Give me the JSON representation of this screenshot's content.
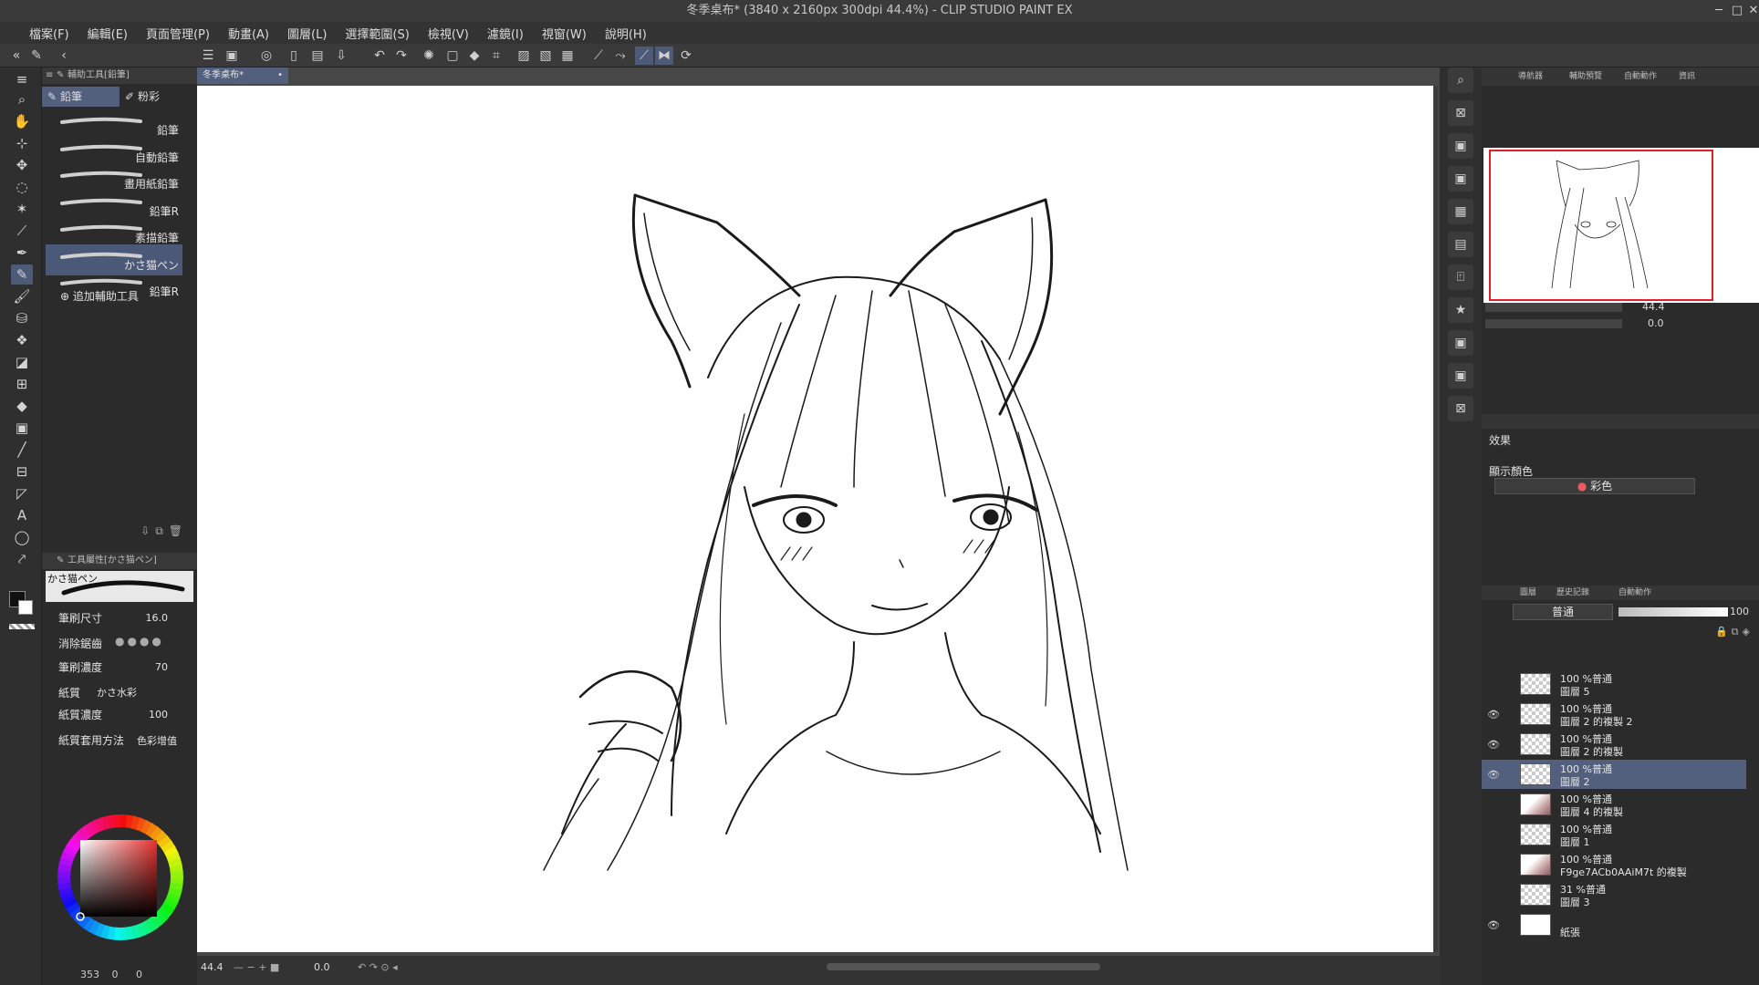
{
  "window": {
    "title": "冬季桌布* (3840 x 2160px 300dpi 44.4%)  - CLIP STUDIO PAINT EX"
  },
  "menu": [
    "檔案(F)",
    "編輯(E)",
    "頁面管理(P)",
    "動畫(A)",
    "圖層(L)",
    "選擇範圍(S)",
    "檢視(V)",
    "濾鏡(I)",
    "視窗(W)",
    "說明(H)"
  ],
  "subtool": {
    "header": "輔助工具[鉛筆]",
    "tabs": [
      "鉛筆",
      "粉彩"
    ],
    "brushes": [
      "鉛筆",
      "自動鉛筆",
      "畫用紙鉛筆",
      "鉛筆R",
      "素描鉛筆",
      "かさ猫ペン",
      "鉛筆R"
    ],
    "selected_brush": "かさ猫ペン",
    "add_label": "追加輔助工具"
  },
  "tool_property": {
    "header": "工具屬性[かさ猫ペン]",
    "preview_name": "かさ猫ペン",
    "brush_size_label": "筆刷尺寸",
    "brush_size_value": "16.0",
    "anti_alias_label": "消除鋸齒",
    "density_label": "筆刷濃度",
    "density_value": "70",
    "paper_label": "紙質",
    "paper_value": "かさ水彩",
    "paper_density_label": "紙質濃度",
    "paper_density_value": "100",
    "paper_apply_label": "紙質套用方法",
    "paper_apply_value": "色彩增值"
  },
  "color_panel": {
    "readout": "353",
    "values": [
      "0",
      "0"
    ],
    "main_color": "#111111",
    "sub_color": "#ffffff",
    "hue_color": "#e8322f"
  },
  "canvas": {
    "doc_tab": "冬季桌布*",
    "zoom": "44.4",
    "rotation": "0.0"
  },
  "navigator": {
    "tabs": [
      "導航器",
      "輔助預覽",
      "自動動作",
      "資訊"
    ],
    "zoom": "44.4",
    "rotation": "0.0"
  },
  "layer_property": {
    "effect_label": "效果",
    "display_color_label": "顯示顏色",
    "display_color_value": "彩色"
  },
  "layers": {
    "tabs": [
      "圖層",
      "歷史記錄",
      "自動動作"
    ],
    "blend_mode": "普通",
    "opacity": "100",
    "list": [
      {
        "mode": "100 %普通",
        "name": "圖層 5",
        "visible": false,
        "selected": false,
        "thumb": "transparent"
      },
      {
        "mode": "100 %普通",
        "name": "圖層 2 的複製 2",
        "visible": true,
        "selected": false,
        "thumb": "transparent"
      },
      {
        "mode": "100 %普通",
        "name": "圖層 2 的複製",
        "visible": true,
        "selected": false,
        "thumb": "transparent"
      },
      {
        "mode": "100 %普通",
        "name": "圖層 2",
        "visible": true,
        "selected": true,
        "thumb": "transparent"
      },
      {
        "mode": "100 %普通",
        "name": "圖層 4 的複製",
        "visible": false,
        "selected": false,
        "thumb": "img"
      },
      {
        "mode": "100 %普通",
        "name": "圖層 1",
        "visible": false,
        "selected": false,
        "thumb": "transparent"
      },
      {
        "mode": "100 %普通",
        "name": "F9ge7ACb0AAiM7t 的複製",
        "visible": false,
        "selected": false,
        "thumb": "img"
      },
      {
        "mode": "31 %普通",
        "name": "圖層 3",
        "visible": false,
        "selected": false,
        "thumb": "transparent"
      },
      {
        "mode": "",
        "name": "紙張",
        "visible": true,
        "selected": false,
        "thumb": "paper"
      }
    ]
  },
  "colors": {
    "accent": "#52607e",
    "nav_frame": "#e01f2b"
  }
}
